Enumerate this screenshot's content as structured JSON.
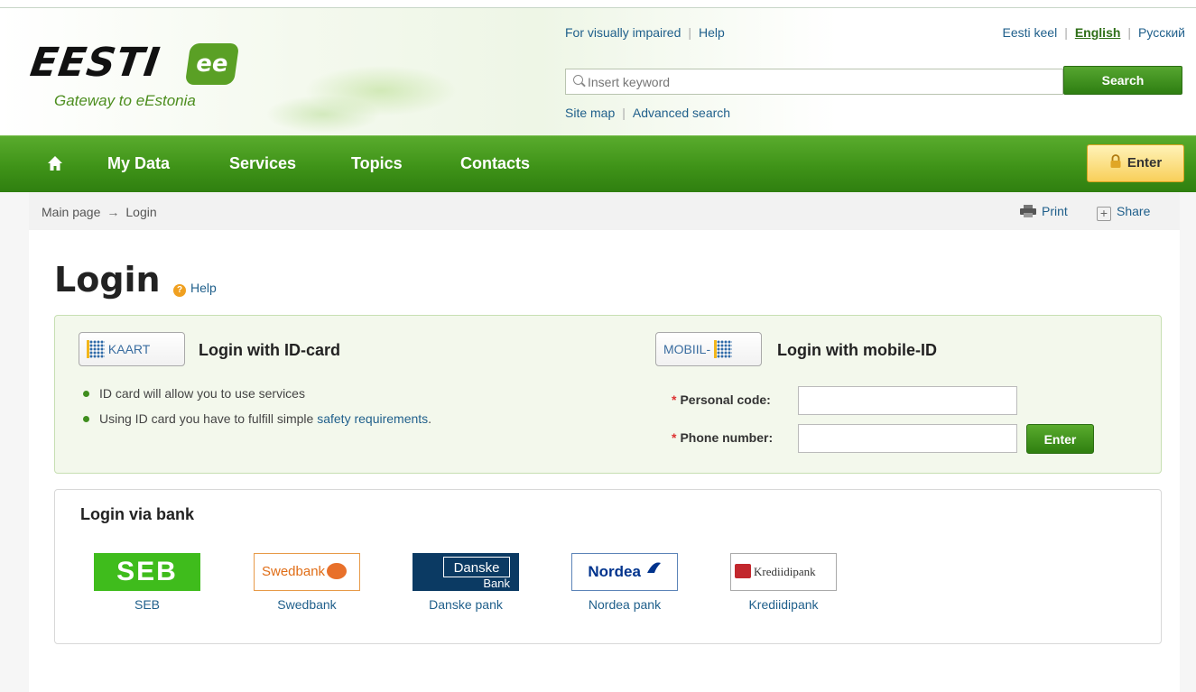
{
  "brand": {
    "logo_word": "EESTI",
    "logo_badge": "ee",
    "tagline": "Gateway to eEstonia"
  },
  "header": {
    "visually_impaired": "For visually impaired",
    "help": "Help",
    "languages": [
      "Eesti keel",
      "English",
      "Русский"
    ],
    "active_language": "English",
    "search_placeholder": "Insert keyword",
    "search_button": "Search",
    "site_map": "Site map",
    "advanced_search": "Advanced search"
  },
  "nav": {
    "items": [
      "My Data",
      "Services",
      "Topics",
      "Contacts"
    ],
    "enter": "Enter"
  },
  "breadcrumb": {
    "home": "Main page",
    "arrow": "→",
    "current": "Login",
    "print": "Print",
    "share": "Share"
  },
  "login": {
    "title": "Login",
    "help": "Help",
    "id_card": {
      "badge": "KAART",
      "title": "Login with ID-card",
      "bullets": [
        "ID card will allow you to use services",
        "Using ID card you have to fulfill simple "
      ],
      "safety_link": "safety requirements",
      "trailing": "."
    },
    "mobile": {
      "badge": "MOBIIL-",
      "title": "Login with mobile-ID",
      "personal_code_label": "Personal code:",
      "phone_label": "Phone number:",
      "required_mark": "*",
      "enter": "Enter"
    }
  },
  "banks": {
    "title": "Login via bank",
    "items": [
      {
        "logo": "SEB",
        "name": "SEB"
      },
      {
        "logo": "Swedbank",
        "name": "Swedbank"
      },
      {
        "logo_line1": "Danske",
        "logo_line2": "Bank",
        "name": "Danske pank"
      },
      {
        "logo": "Nordea",
        "name": "Nordea pank"
      },
      {
        "logo": "Krediidipank",
        "name": "Krediidipank"
      }
    ]
  },
  "colors": {
    "brand_green": "#3f9318",
    "link_blue": "#1f5f8b",
    "enter_yellow": "#f8cf5a"
  }
}
